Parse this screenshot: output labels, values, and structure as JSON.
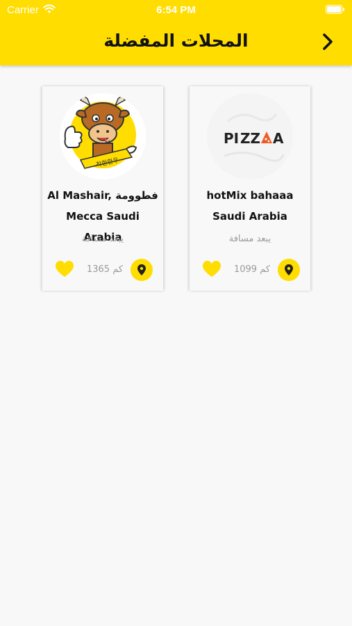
{
  "status": {
    "carrier": "Carrier",
    "time": "6:54 PM"
  },
  "header": {
    "title": "المحلات المفضلة"
  },
  "colors": {
    "accent": "#ffdd00"
  },
  "cards": [
    {
      "name": "hotMix  bahaaa Saudi Arabia",
      "distance_label": "يبعد مسافة",
      "distance_value": "1099 كم",
      "logo_text": "PIZZA"
    },
    {
      "name": "Al Mashair, فطوومة Mecca Saudi Arabia",
      "distance_label": "يبعد مسافة",
      "distance_value": "1365 كم",
      "logo_text": "착한한우"
    }
  ]
}
